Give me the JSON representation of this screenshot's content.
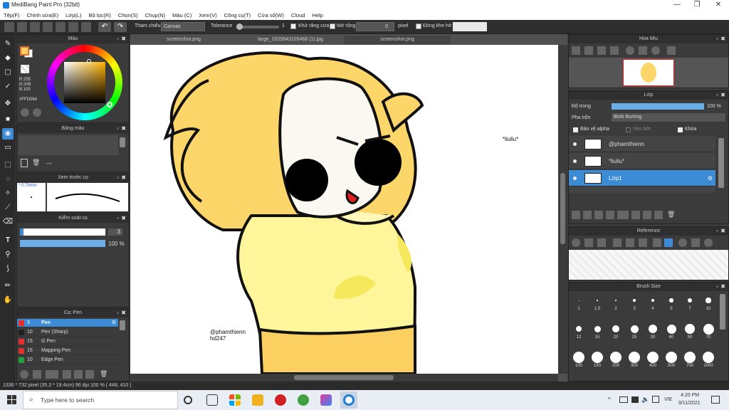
{
  "window": {
    "title": "MediBang Paint Pro (32bit)",
    "minimize": "—",
    "maximize": "❐",
    "close": "✕"
  },
  "menu": [
    "Tệp(F)",
    "Chỉnh sửa(E)",
    "Lớp(L)",
    "Bộ lọc(R)",
    "Chọn(S)",
    "Chụp(N)",
    "Màu (C)",
    "Xem(V)",
    "Công cụ(T)",
    "Cửa sổ(W)",
    "Cloud",
    "Help"
  ],
  "toolbar": {
    "ref_label": "Tham chiếu",
    "ref_value": "Canvas",
    "tolerance_label": "Tolerance",
    "tolerance_value": "1",
    "antialias_label": "Khử răng cưa",
    "expand_label": "Mở rộng",
    "expand_value": "0",
    "expand_unit": "pixel",
    "close_gap_label": "Đóng khe hở"
  },
  "color_panel": {
    "title": "Màu",
    "r": "R:255",
    "g": "G:208",
    "b": "B:100",
    "hex": "#FFD064",
    "primary": "#FFD064",
    "secondary": "#ffffff"
  },
  "palette_panel": {
    "title": "Bảng màu",
    "dash": "---"
  },
  "brush_preview": {
    "title": "Xem trước cọ",
    "size": "0.79mm"
  },
  "control_panel": {
    "title": "Kiểm soát cọ",
    "size_value": "3",
    "opacity_value": "100 %",
    "opacity_fraction": 1.0
  },
  "brush_panel": {
    "title": "Cọ: Pen",
    "items": [
      {
        "size": "3",
        "name": "Pen",
        "color": "#e03030",
        "selected": true
      },
      {
        "size": "10",
        "name": "Pen (Sharp)",
        "color": "#222222",
        "selected": false
      },
      {
        "size": "15",
        "name": "G Pen",
        "color": "#e03030",
        "selected": false
      },
      {
        "size": "15",
        "name": "Mapping Pen",
        "color": "#e03030",
        "selected": false
      },
      {
        "size": "10",
        "name": "Edge Pen",
        "color": "#20a040",
        "selected": false
      }
    ]
  },
  "tabs": [
    "screenshot.png",
    "large_1625843105468 (1).jpg",
    "screenshot.png"
  ],
  "canvas_texts": {
    "liuliu": "*liuliu*",
    "sig1": "@phamthienn",
    "sig2": "hd247"
  },
  "navigator": {
    "title": "Hoa tiêu"
  },
  "layer_panel": {
    "title": "Lớp",
    "opacity_label": "Độ trong",
    "opacity_value": "100 %",
    "opacity_fraction": 1.0,
    "blend_label": "Pha trộn",
    "blend_value": "Bình thường",
    "protect_alpha": "Bảo vệ alpha",
    "clip": "Xén bớt",
    "lock": "Khóa",
    "layers": [
      {
        "name": "@phamthienn",
        "selected": false
      },
      {
        "name": "*liuliu*",
        "selected": false
      },
      {
        "name": "Lớp1",
        "selected": true
      }
    ]
  },
  "reference_panel": {
    "title": "Reference"
  },
  "brush_size_panel": {
    "title": "Brush Size",
    "sizes": [
      "1",
      "1.5",
      "2",
      "3",
      "4",
      "5",
      "7",
      "10",
      "12",
      "15",
      "20",
      "25",
      "30",
      "40",
      "50",
      "70",
      "100",
      "150",
      "200",
      "300",
      "400",
      "500",
      "700",
      "1000"
    ]
  },
  "status": {
    "text": "1336 * 732 pixel   (35.3 * 19.4cm)   96 dpi   100 %   ( 448, 410 )"
  },
  "taskbar": {
    "search_placeholder": "Type here to search",
    "time": "4:20 PM",
    "date": "9/11/2021",
    "lang": "VIE"
  }
}
